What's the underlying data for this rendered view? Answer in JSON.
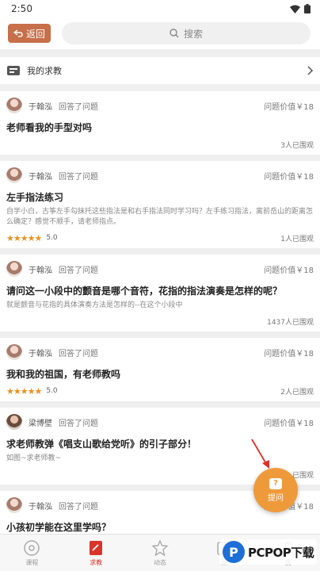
{
  "status_bar": {
    "time": "2:50"
  },
  "header": {
    "back_label": "返回",
    "search_placeholder": "搜索"
  },
  "my_help": {
    "label": "我的求教"
  },
  "questions": [
    {
      "author": "于翰泓",
      "action": "回答了问题",
      "value": "问题价值￥18",
      "title": "老师看我的手型对吗",
      "description": "",
      "stars": "",
      "score": "",
      "views": "3人已围观"
    },
    {
      "author": "于翰泓",
      "action": "回答了问题",
      "value": "问题价值￥18",
      "title": "左手指法练习",
      "description": "自学小白，古筝左手勾抹托这些指法是和右手指法同时学习吗？左手练习指法，离前岳山的距离怎么确定？感觉不顺手，请老师指点。",
      "stars": "★★★★★",
      "score": "5.0",
      "views": "1人已围观"
    },
    {
      "author": "于翰泓",
      "action": "回答了问题",
      "value": "问题价值￥18",
      "title": "请问这一小段中的颤音是哪个音符，花指的指法演奏是怎样的呢？",
      "description": "就是颤音与花指的具体演奏方法是怎样的--在这个小段中",
      "stars": "",
      "score": "",
      "views": "1437人已围观"
    },
    {
      "author": "于翰泓",
      "action": "回答了问题",
      "value": "问题价值￥18",
      "title": "我和我的祖国，有老师教吗",
      "description": "",
      "stars": "★★★★★",
      "score": "5.0",
      "views": "2人已围观"
    },
    {
      "author": "梁博壁",
      "action": "回答了问题",
      "value": "问题价值￥18",
      "title": "求老师教弹《唱支山歌给党听》的引子部分！",
      "description": "如图~求老师教~",
      "stars": "",
      "score": "",
      "views": "已围观"
    },
    {
      "author": "于翰泓",
      "action": "回答了问题",
      "value": "问题价值￥18",
      "title": "小孩初学能在这里学吗？",
      "description": "",
      "stars": "",
      "score": "",
      "views": ""
    }
  ],
  "fab": {
    "icon": "?",
    "label": "提问"
  },
  "nav": {
    "courses": "课程",
    "help": "求教",
    "feed": "动态",
    "tab4": "课",
    "tab5": "我"
  },
  "watermark": {
    "letter": "P",
    "text": "PCPOP下载"
  },
  "colors": {
    "accent": "#c66f49",
    "active": "#d9352b",
    "fab": "#ef9a3a",
    "star": "#e8911f"
  }
}
